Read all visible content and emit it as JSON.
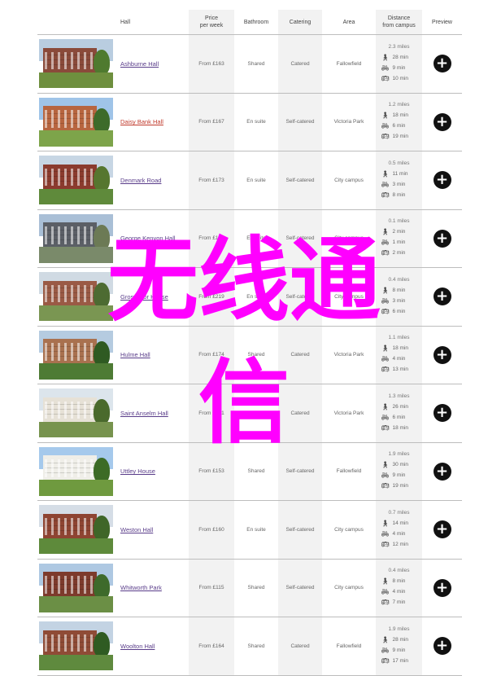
{
  "headers": {
    "hall": "Hall",
    "price": "Price\nper week",
    "bathroom": "Bathroom",
    "catering": "Catering",
    "area": "Area",
    "distance": "Distance\nfrom campus",
    "preview": "Preview"
  },
  "icons": {
    "walk": "walking-icon",
    "bike": "bicycle-icon",
    "bus": "bus-icon",
    "preview": "plus-circle-icon"
  },
  "colors": {
    "link": "#5a3d8a",
    "selected_link": "#c0392b",
    "overlay": "#ff00ff",
    "button": "#111111"
  },
  "overlay": {
    "line1": "无线通",
    "line2": "信"
  },
  "halls": [
    {
      "name": "Ashburne Hall",
      "price": "From £163",
      "bathroom": "Shared",
      "catering": "Catered",
      "area": "Fallowfield",
      "miles": "2.3 miles",
      "walk": "28 min",
      "bike": "9 min",
      "bus": "10 min"
    },
    {
      "name": "Daisy Bank Hall",
      "price": "From £167",
      "bathroom": "En suite",
      "catering": "Self-catered",
      "area": "Victoria Park",
      "miles": "1.2 miles",
      "walk": "18 min",
      "bike": "6 min",
      "bus": "19 min"
    },
    {
      "name": "Denmark Road",
      "price": "From £173",
      "bathroom": "En suite",
      "catering": "Self-catered",
      "area": "City campus",
      "miles": "0.5 miles",
      "walk": "11 min",
      "bike": "3 min",
      "bus": "8 min"
    },
    {
      "name": "George Kenyon Hall",
      "price": "From £162",
      "bathroom": "En suite",
      "catering": "Self-catered",
      "area": "City campus",
      "miles": "0.1 miles",
      "walk": "2 min",
      "bike": "1 min",
      "bus": "2 min"
    },
    {
      "name": "Grosvenor House",
      "price": "From £219",
      "bathroom": "En suite",
      "catering": "Self-catered",
      "area": "City campus",
      "miles": "0.4 miles",
      "walk": "8 min",
      "bike": "3 min",
      "bus": "6 min"
    },
    {
      "name": "Hulme Hall",
      "price": "From £174",
      "bathroom": "Shared",
      "catering": "Catered",
      "area": "Victoria Park",
      "miles": "1.1 miles",
      "walk": "18 min",
      "bike": "4 min",
      "bus": "13 min"
    },
    {
      "name": "Saint Anselm Hall",
      "price": "From £171",
      "bathroom": "Shared",
      "catering": "Catered",
      "area": "Victoria Park",
      "miles": "1.3 miles",
      "walk": "26 min",
      "bike": "6 min",
      "bus": "18 min"
    },
    {
      "name": "Uttley House",
      "price": "From £153",
      "bathroom": "Shared",
      "catering": "Self-catered",
      "area": "Fallowfield",
      "miles": "1.9 miles",
      "walk": "30 min",
      "bike": "9 min",
      "bus": "19 min"
    },
    {
      "name": "Weston Hall",
      "price": "From £160",
      "bathroom": "En suite",
      "catering": "Self-catered",
      "area": "City campus",
      "miles": "0.7 miles",
      "walk": "14 min",
      "bike": "4 min",
      "bus": "12 min"
    },
    {
      "name": "Whitworth Park",
      "price": "From £115",
      "bathroom": "Shared",
      "catering": "Self-catered",
      "area": "City campus",
      "miles": "0.4 miles",
      "walk": "8 min",
      "bike": "4 min",
      "bus": "7 min"
    },
    {
      "name": "Woolton Hall",
      "price": "From £164",
      "bathroom": "Shared",
      "catering": "Catered",
      "area": "Fallowfield",
      "miles": "1.9 miles",
      "walk": "28 min",
      "bike": "9 min",
      "bus": "17 min"
    }
  ]
}
